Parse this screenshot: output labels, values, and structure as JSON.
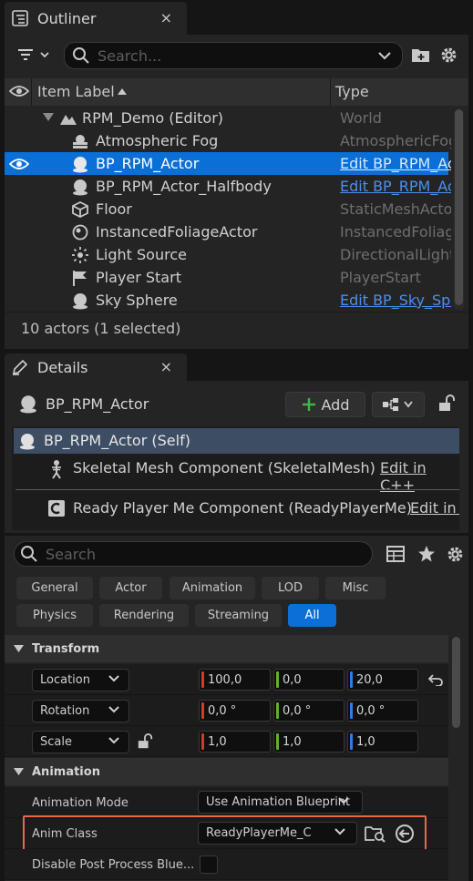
{
  "outliner": {
    "tab_title": "Outliner",
    "close_glyph": "×",
    "search_placeholder": "Search...",
    "col_label": "Item Label",
    "col_type": "Type",
    "rows": [
      {
        "label": "RPM_Demo (Editor)",
        "type": "World",
        "icon": "world-icon"
      },
      {
        "label": "Atmospheric Fog",
        "type": "AtmosphericFog",
        "icon": "fog-icon"
      },
      {
        "label": "BP_RPM_Actor",
        "type": "Edit BP_RPM_Actor",
        "icon": "blueprint-sphere-icon"
      },
      {
        "label": "BP_RPM_Actor_Halfbody",
        "type": "Edit BP_RPM_Actor_Halfbody",
        "icon": "blueprint-sphere-icon"
      },
      {
        "label": "Floor",
        "type": "StaticMeshActor",
        "icon": "cube-icon"
      },
      {
        "label": "InstancedFoliageActor",
        "type": "InstancedFoliageActor",
        "icon": "sphere-icon"
      },
      {
        "label": "Light Source",
        "type": "DirectionalLight",
        "icon": "sun-icon"
      },
      {
        "label": "Player Start",
        "type": "PlayerStart",
        "icon": "flag-icon"
      },
      {
        "label": "Sky Sphere",
        "type": "Edit BP_Sky_Sphere",
        "icon": "blueprint-sphere-icon"
      }
    ],
    "status": "10 actors (1 selected)"
  },
  "details": {
    "tab_title": "Details",
    "close_glyph": "×",
    "actor_name": "BP_RPM_Actor",
    "add_label": "Add",
    "components": {
      "self": "BP_RPM_Actor (Self)",
      "skeletal": "Skeletal Mesh Component (SkeletalMesh)",
      "skeletal_link": "Edit in C++",
      "rpm": "Ready Player Me Component (ReadyPlayerMe)",
      "rpm_link": "Edit in C++"
    },
    "search_placeholder": "Search",
    "filters_row1": [
      "General",
      "Actor",
      "Animation",
      "LOD",
      "Misc"
    ],
    "filters_row2": [
      "Physics",
      "Rendering",
      "Streaming",
      "All"
    ],
    "transform": {
      "title": "Transform",
      "location": {
        "label": "Location",
        "x": "100,0",
        "y": "0,0",
        "z": "20,0"
      },
      "rotation": {
        "label": "Rotation",
        "x": "0,0 °",
        "y": "0,0 °",
        "z": "0,0 °"
      },
      "scale": {
        "label": "Scale",
        "x": "1,0",
        "y": "1,0",
        "z": "1,0"
      }
    },
    "animation": {
      "title": "Animation",
      "mode_label": "Animation Mode",
      "mode_value": "Use Animation Blueprint",
      "class_label": "Anim Class",
      "class_value": "ReadyPlayerMe_C",
      "disable_label": "Disable Post Process Blue..."
    }
  },
  "colors": {
    "accent": "#0b6fd8",
    "link": "#4c8ff0",
    "x_axis": "#d43a2a",
    "y_axis": "#5fb32a",
    "z_axis": "#2f7de0",
    "highlight": "#e8694a",
    "add_green": "#3fb83f"
  }
}
